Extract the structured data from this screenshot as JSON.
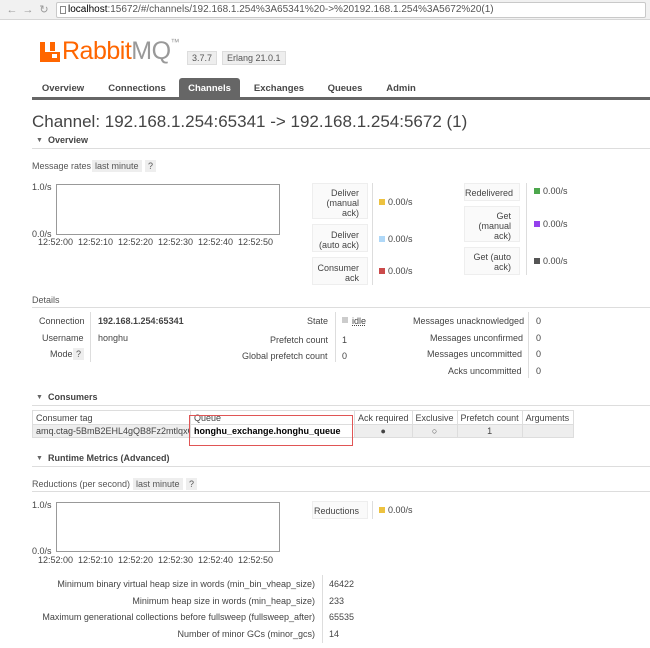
{
  "browser": {
    "url_host": "localhost",
    "url_rest": ":15672/#/channels/192.168.1.254%3A65341%20->%20192.168.1.254%3A5672%20(1)"
  },
  "header": {
    "logo_rabbit": "Rabbit",
    "logo_mq": "MQ",
    "logo_tm": "™",
    "version": "3.7.7",
    "erlang": "Erlang 21.0.1"
  },
  "tabs": [
    {
      "label": "Overview"
    },
    {
      "label": "Connections"
    },
    {
      "label": "Channels"
    },
    {
      "label": "Exchanges"
    },
    {
      "label": "Queues"
    },
    {
      "label": "Admin"
    }
  ],
  "title": "Channel: 192.168.1.254:65341 -> 192.168.1.254:5672 (1)",
  "overview": {
    "section": "Overview",
    "rates_label": "Message rates",
    "last_minute": "last minute",
    "help": "?",
    "y_top": "1.0/s",
    "y_bottom": "0.0/s",
    "x_ticks": [
      "12:52:00",
      "12:52:10",
      "12:52:20",
      "12:52:30",
      "12:52:40",
      "12:52:50"
    ],
    "left_rates": [
      {
        "l1": "Deliver",
        "l2": "(manual",
        "l3": "ack)",
        "value": "0.00/s",
        "color": "#edc240"
      },
      {
        "l1": "Deliver",
        "l2": "(auto ack)",
        "value": "0.00/s",
        "color": "#afd8f8"
      },
      {
        "l1": "Consumer",
        "l2": "ack",
        "value": "0.00/s",
        "color": "#cb4b4b"
      }
    ],
    "right_rates": [
      {
        "l1": "Redelivered",
        "value": "0.00/s",
        "color": "#4da74d"
      },
      {
        "l1": "Get",
        "l2": "(manual",
        "l3": "ack)",
        "value": "0.00/s",
        "color": "#9440ed"
      },
      {
        "l1": "Get (auto",
        "l2": "ack)",
        "value": "0.00/s",
        "color": "#555555"
      }
    ]
  },
  "details": {
    "label": "Details",
    "connection_k": "Connection",
    "connection_v": "192.168.1.254:65341",
    "username_k": "Username",
    "username_v": "honghu",
    "mode_k": "Mode",
    "mode_help": "?",
    "state_k": "State",
    "state_v": "idle",
    "prefetch_k": "Prefetch count",
    "prefetch_v": "1",
    "gprefetch_k": "Global prefetch count",
    "gprefetch_v": "0",
    "unacked_k": "Messages unacknowledged",
    "unacked_v": "0",
    "unconfirmed_k": "Messages unconfirmed",
    "unconfirmed_v": "0",
    "uncommitted_k": "Messages uncommitted",
    "uncommitted_v": "0",
    "acks_unc_k": "Acks uncommitted",
    "acks_unc_v": "0"
  },
  "consumers": {
    "section": "Consumers",
    "headers": [
      "Consumer tag",
      "Queue",
      "Ack required",
      "Exclusive",
      "Prefetch count",
      "Arguments"
    ],
    "row": {
      "tag": "amq.ctag-5BmB2EHL4gQB8Fz2mtlqxQ",
      "queue": "honghu_exchange.honghu_queue",
      "ack": "●",
      "exclusive": "○",
      "prefetch": "1",
      "args": ""
    }
  },
  "runtime": {
    "section": "Runtime Metrics (Advanced)",
    "reductions_label": "Reductions (per second)",
    "last_minute": "last minute",
    "help": "?",
    "y_top": "1.0/s",
    "y_bottom": "0.0/s",
    "x_ticks": [
      "12:52:00",
      "12:52:10",
      "12:52:20",
      "12:52:30",
      "12:52:40",
      "12:52:50"
    ],
    "reductions_key": "Reductions",
    "reductions_value": "0.00/s",
    "reductions_color": "#edc240",
    "metrics": [
      {
        "k": "Minimum binary virtual heap size in words (min_bin_vheap_size)",
        "v": "46422"
      },
      {
        "k": "Minimum heap size in words (min_heap_size)",
        "v": "233"
      },
      {
        "k": "Maximum generational collections before fullsweep (fullsweep_after)",
        "v": "65535"
      },
      {
        "k": "Number of minor GCs (minor_gcs)",
        "v": "14"
      }
    ]
  }
}
